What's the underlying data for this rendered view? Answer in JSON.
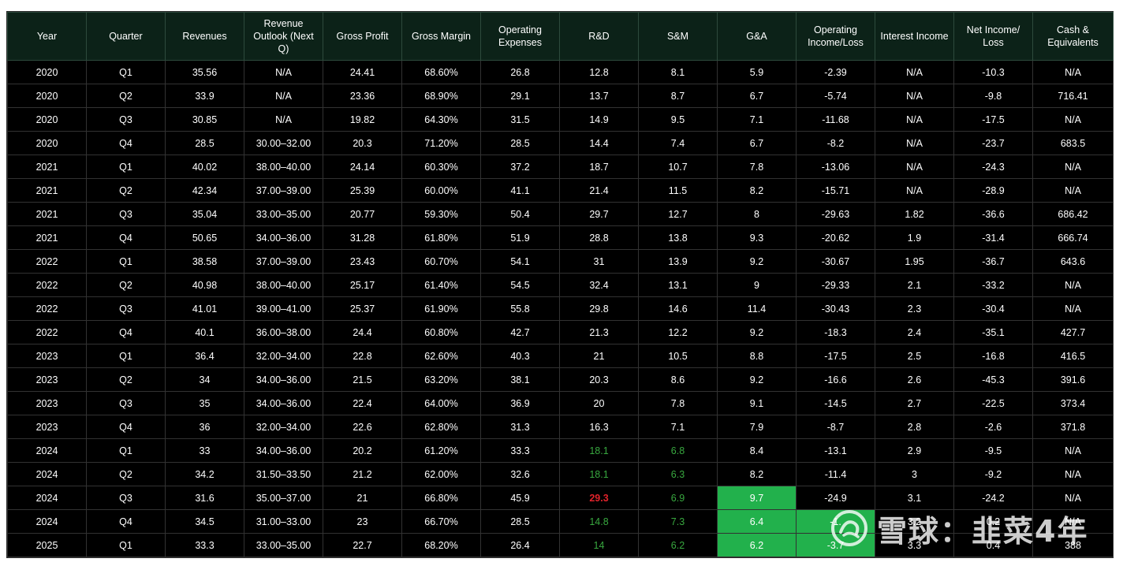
{
  "table": {
    "headers": [
      "Year",
      "Quarter",
      "Revenues",
      "Revenue Outlook (Next Q)",
      "Gross Profit",
      "Gross Margin",
      "Operating Expenses",
      "R&D",
      "S&M",
      "G&A",
      "Operating Income/Loss",
      "Interest Income",
      "Net Income/ Loss",
      "Cash & Equivalents"
    ],
    "rows": [
      [
        "2020",
        "Q1",
        "35.56",
        "N/A",
        "24.41",
        "68.60%",
        "26.8",
        "12.8",
        "8.1",
        "5.9",
        "-2.39",
        "N/A",
        "-10.3",
        "N/A"
      ],
      [
        "2020",
        "Q2",
        "33.9",
        "N/A",
        "23.36",
        "68.90%",
        "29.1",
        "13.7",
        "8.7",
        "6.7",
        "-5.74",
        "N/A",
        "-9.8",
        "716.41"
      ],
      [
        "2020",
        "Q3",
        "30.85",
        "N/A",
        "19.82",
        "64.30%",
        "31.5",
        "14.9",
        "9.5",
        "7.1",
        "-11.68",
        "N/A",
        "-17.5",
        "N/A"
      ],
      [
        "2020",
        "Q4",
        "28.5",
        "30.00–32.00",
        "20.3",
        "71.20%",
        "28.5",
        "14.4",
        "7.4",
        "6.7",
        "-8.2",
        "N/A",
        "-23.7",
        "683.5"
      ],
      [
        "2021",
        "Q1",
        "40.02",
        "38.00–40.00",
        "24.14",
        "60.30%",
        "37.2",
        "18.7",
        "10.7",
        "7.8",
        "-13.06",
        "N/A",
        "-24.3",
        "N/A"
      ],
      [
        "2021",
        "Q2",
        "42.34",
        "37.00–39.00",
        "25.39",
        "60.00%",
        "41.1",
        "21.4",
        "11.5",
        "8.2",
        "-15.71",
        "N/A",
        "-28.9",
        "N/A"
      ],
      [
        "2021",
        "Q3",
        "35.04",
        "33.00–35.00",
        "20.77",
        "59.30%",
        "50.4",
        "29.7",
        "12.7",
        "8",
        "-29.63",
        "1.82",
        "-36.6",
        "686.42"
      ],
      [
        "2021",
        "Q4",
        "50.65",
        "34.00–36.00",
        "31.28",
        "61.80%",
        "51.9",
        "28.8",
        "13.8",
        "9.3",
        "-20.62",
        "1.9",
        "-31.4",
        "666.74"
      ],
      [
        "2022",
        "Q1",
        "38.58",
        "37.00–39.00",
        "23.43",
        "60.70%",
        "54.1",
        "31",
        "13.9",
        "9.2",
        "-30.67",
        "1.95",
        "-36.7",
        "643.6"
      ],
      [
        "2022",
        "Q2",
        "40.98",
        "38.00–40.00",
        "25.17",
        "61.40%",
        "54.5",
        "32.4",
        "13.1",
        "9",
        "-29.33",
        "2.1",
        "-33.2",
        "N/A"
      ],
      [
        "2022",
        "Q3",
        "41.01",
        "39.00–41.00",
        "25.37",
        "61.90%",
        "55.8",
        "29.8",
        "14.6",
        "11.4",
        "-30.43",
        "2.3",
        "-30.4",
        "N/A"
      ],
      [
        "2022",
        "Q4",
        "40.1",
        "36.00–38.00",
        "24.4",
        "60.80%",
        "42.7",
        "21.3",
        "12.2",
        "9.2",
        "-18.3",
        "2.4",
        "-35.1",
        "427.7"
      ],
      [
        "2023",
        "Q1",
        "36.4",
        "32.00–34.00",
        "22.8",
        "62.60%",
        "40.3",
        "21",
        "10.5",
        "8.8",
        "-17.5",
        "2.5",
        "-16.8",
        "416.5"
      ],
      [
        "2023",
        "Q2",
        "34",
        "34.00–36.00",
        "21.5",
        "63.20%",
        "38.1",
        "20.3",
        "8.6",
        "9.2",
        "-16.6",
        "2.6",
        "-45.3",
        "391.6"
      ],
      [
        "2023",
        "Q3",
        "35",
        "34.00–36.00",
        "22.4",
        "64.00%",
        "36.9",
        "20",
        "7.8",
        "9.1",
        "-14.5",
        "2.7",
        "-22.5",
        "373.4"
      ],
      [
        "2023",
        "Q4",
        "36",
        "32.00–34.00",
        "22.6",
        "62.80%",
        "31.3",
        "16.3",
        "7.1",
        "7.9",
        "-8.7",
        "2.8",
        "-2.6",
        "371.8"
      ],
      [
        "2024",
        "Q1",
        "33",
        "34.00–36.00",
        "20.2",
        "61.20%",
        "33.3",
        "18.1",
        "6.8",
        "8.4",
        "-13.1",
        "2.9",
        "-9.5",
        "N/A"
      ],
      [
        "2024",
        "Q2",
        "34.2",
        "31.50–33.50",
        "21.2",
        "62.00%",
        "32.6",
        "18.1",
        "6.3",
        "8.2",
        "-11.4",
        "3",
        "-9.2",
        "N/A"
      ],
      [
        "2024",
        "Q3",
        "31.6",
        "35.00–37.00",
        "21",
        "66.80%",
        "45.9",
        "29.3",
        "6.9",
        "9.7",
        "-24.9",
        "3.1",
        "-24.2",
        "N/A"
      ],
      [
        "2024",
        "Q4",
        "34.5",
        "31.00–33.00",
        "23",
        "66.70%",
        "28.5",
        "14.8",
        "7.3",
        "6.4",
        "-1.",
        "3.2",
        "0.2",
        "N/A"
      ],
      [
        "2025",
        "Q1",
        "33.3",
        "33.00–35.00",
        "22.7",
        "68.20%",
        "26.4",
        "14",
        "6.2",
        "6.2",
        "-3.7",
        "3.3",
        "0.4",
        "388"
      ]
    ],
    "cell_styles": {
      "16": {
        "7": "good",
        "8": "good"
      },
      "17": {
        "7": "good",
        "8": "good"
      },
      "18": {
        "7": "bad",
        "8": "good",
        "9": "hl"
      },
      "19": {
        "7": "good",
        "8": "good",
        "9": "hl",
        "10": "hl"
      },
      "20": {
        "7": "good",
        "8": "good",
        "9": "hl",
        "10": "hl"
      }
    }
  },
  "colors": {
    "header_bg": "#0c2218",
    "table_bg": "#000000",
    "good_text": "#38a83f",
    "bad_text": "#e0232b",
    "highlight_bg": "#22b14c"
  },
  "watermark": {
    "text": "雪球：韭菜4年",
    "icon": "xueqiu-logo-icon"
  }
}
